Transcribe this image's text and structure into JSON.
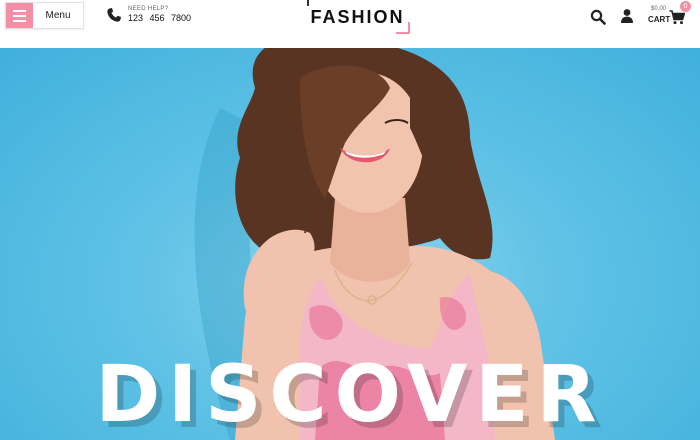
{
  "header": {
    "menu_label": "Menu",
    "help_label": "NEED HELP?",
    "phone": "123 456 7800",
    "logo": "FASHION",
    "cart_price": "$0.00",
    "cart_label": "CART",
    "cart_count": "0"
  },
  "hero": {
    "title": "DISCOVER"
  },
  "colors": {
    "accent": "#f48fa6",
    "hero_bg": "#5fc2e6"
  },
  "icons": [
    "menu-icon",
    "phone-icon",
    "search-icon",
    "user-icon",
    "cart-icon"
  ]
}
